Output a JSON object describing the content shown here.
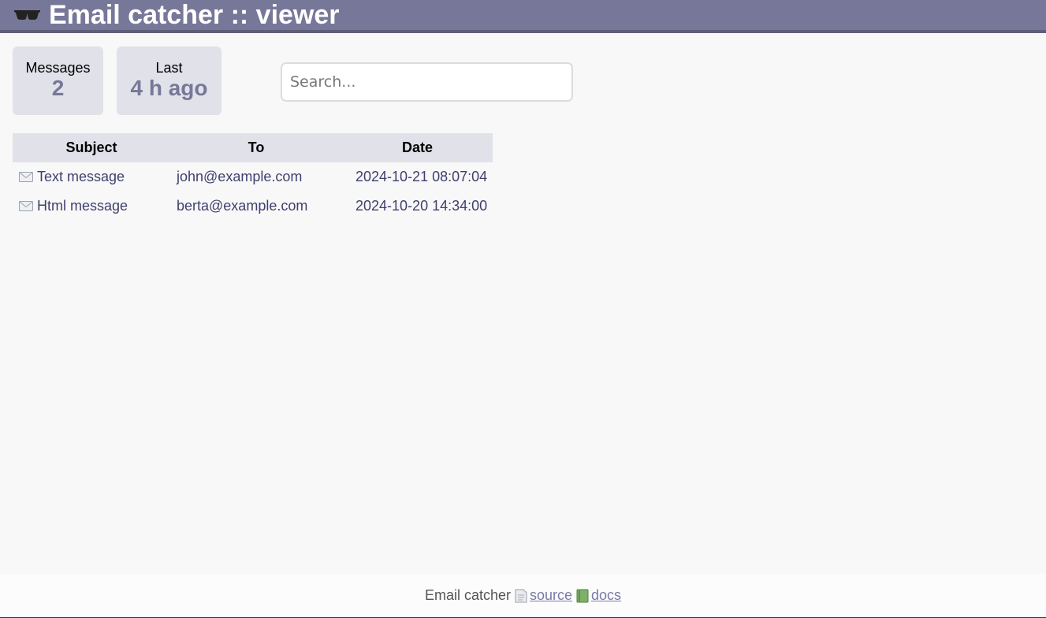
{
  "header": {
    "title": "Email catcher :: viewer",
    "logo_icon": "sunglasses-icon"
  },
  "stats": {
    "messages_label": "Messages",
    "messages_value": "2",
    "last_label": "Last",
    "last_value": "4 h ago"
  },
  "search": {
    "placeholder": "Search...",
    "value": ""
  },
  "table": {
    "headers": [
      "Subject",
      "To",
      "Date"
    ],
    "rows": [
      {
        "subject": "Text message",
        "to": "john@example.com",
        "date": "2024-10-21 08:07:04",
        "icon": "envelope-icon"
      },
      {
        "subject": "Html message",
        "to": "berta@example.com",
        "date": "2024-10-20 14:34:00",
        "icon": "envelope-icon"
      }
    ]
  },
  "footer": {
    "app_name": "Email catcher",
    "source_label": "source",
    "source_icon": "page-icon",
    "docs_label": "docs",
    "docs_icon": "book-icon"
  },
  "colors": {
    "accent": "#777799",
    "header_border": "#5e5e78",
    "stat_bg": "#e1e1e9",
    "link": "#3f3f6e",
    "footer_link": "#7a7aaa"
  }
}
